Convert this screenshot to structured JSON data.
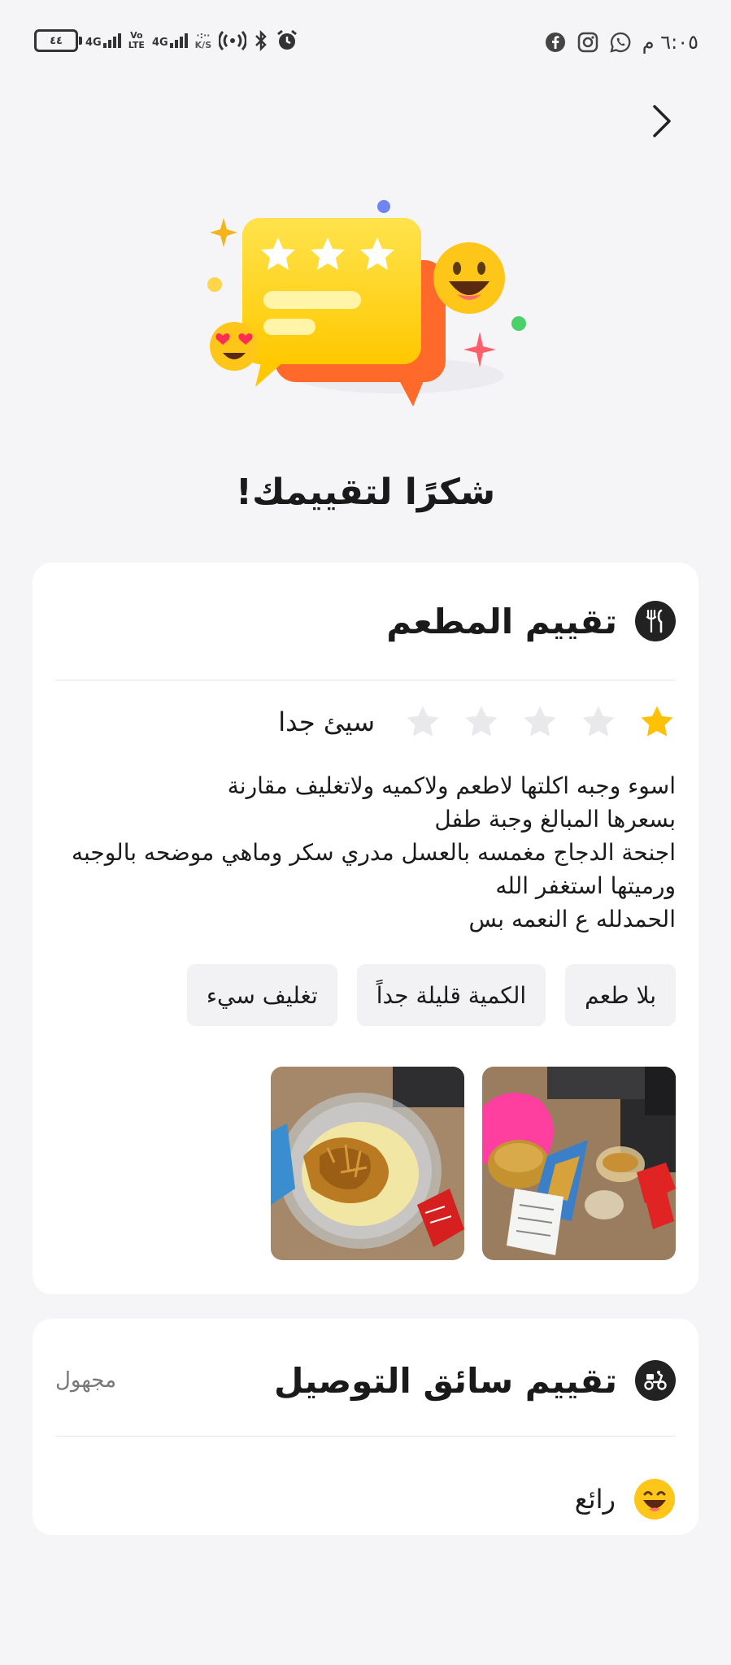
{
  "status": {
    "time": "٦:٠٥ م",
    "battery": "٤٤",
    "net1": "4G",
    "volte_top": "Vo",
    "volte_bottom": "LTE",
    "net2": "4G",
    "speed_top": "·:··",
    "speed_bottom": "K/S"
  },
  "page": {
    "title": "شكرًا لتقييمك!"
  },
  "restaurant": {
    "title": "تقييم المطعم",
    "rating_value": 1,
    "rating_max": 5,
    "rating_label": "سيئ جدا",
    "comment": "اسوء وجبه اكلتها لاطعم ولاكميه ولاتغليف مقارنة\nبسعرها المبالغ وجبة طفل\nاجنحة الدجاج مغمسه بالعسل مدري سكر وماهي موضحه بالوجبه\nورميتها استغفر الله\nالحمدلله ع النعمه بس",
    "tags": [
      "بلا طعم",
      "الكمية قليلة جداً",
      "تغليف سيء"
    ]
  },
  "driver": {
    "title": "تقييم سائق التوصيل",
    "anonymous_label": "مجهول",
    "rating_label": "رائع"
  },
  "colors": {
    "star_active": "#FFC107",
    "star_inactive": "#E9E9EC",
    "icon_bg": "#222222"
  }
}
